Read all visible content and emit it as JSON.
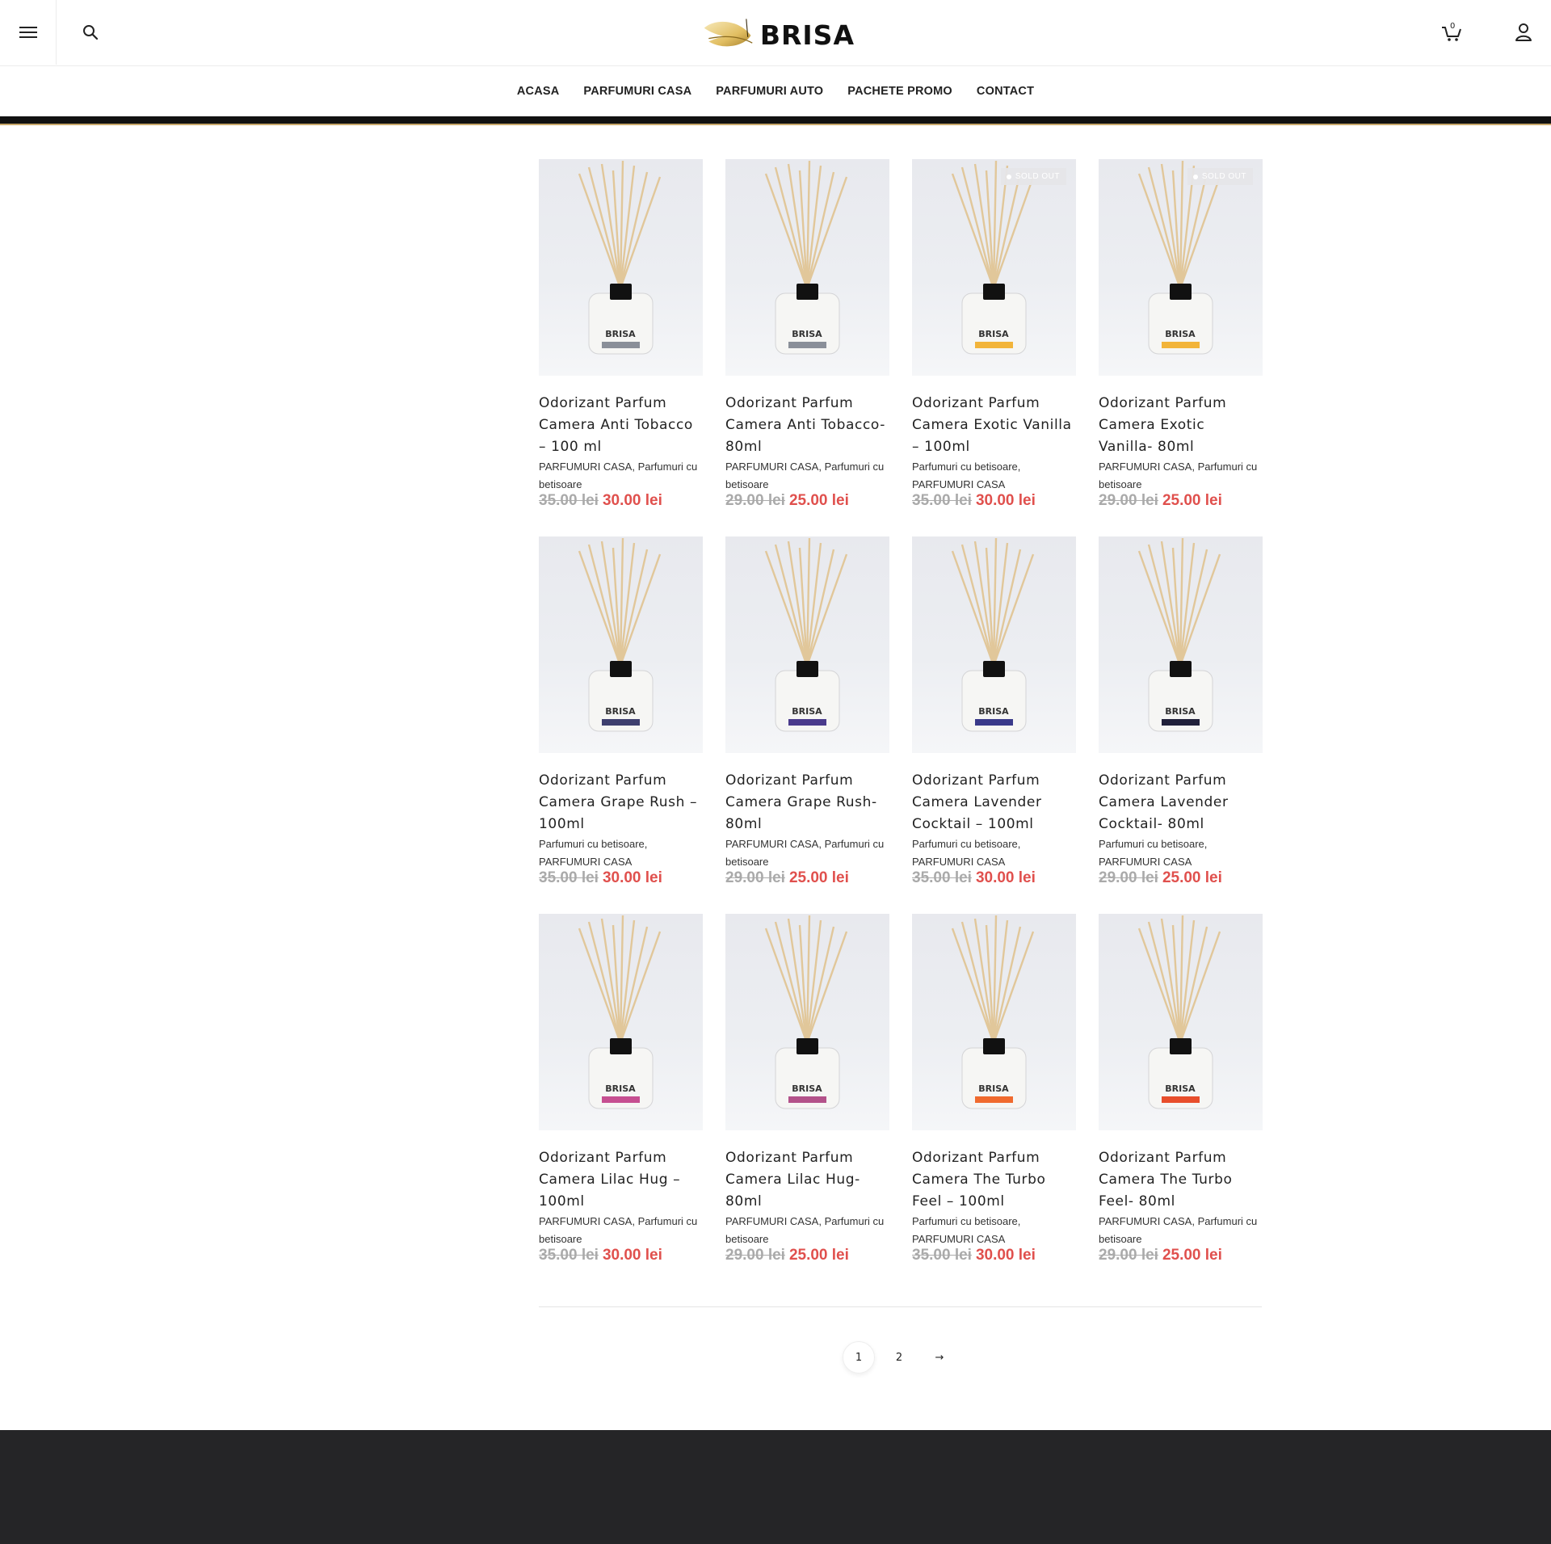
{
  "header": {
    "menu_icon": "hamburger-icon",
    "search_icon": "search-icon",
    "logo_text": "BRISA",
    "cart_count": "0",
    "cart_icon": "cart-icon",
    "account_icon": "user-icon"
  },
  "nav": {
    "items": [
      {
        "label": "ACASA"
      },
      {
        "label": "PARFUMURI CASA"
      },
      {
        "label": "PARFUMURI AUTO"
      },
      {
        "label": "PACHETE PROMO"
      },
      {
        "label": "CONTACT"
      }
    ]
  },
  "colors": {
    "sale_price": "#e0504d",
    "old_price": "#aaaaaa",
    "footer_bg": "#252527"
  },
  "products": [
    {
      "title": "Odorizant Parfum Camera Anti Tobacco – 100 ml",
      "cat1": "PARFUMURI CASA",
      "cat2": "Parfumuri cu betisoare",
      "old_price": "35.00 lei",
      "price": "30.00 lei",
      "badge": "",
      "label_color": "#8a8f99"
    },
    {
      "title": "Odorizant Parfum Camera Anti Tobacco- 80ml",
      "cat1": "PARFUMURI CASA",
      "cat2": "Parfumuri cu betisoare",
      "old_price": "29.00 lei",
      "price": "25.00 lei",
      "badge": "",
      "label_color": "#8a8f99"
    },
    {
      "title": "Odorizant Parfum Camera Exotic Vanilla – 100ml",
      "cat1": "Parfumuri cu betisoare",
      "cat2": "PARFUMURI CASA",
      "old_price": "35.00 lei",
      "price": "30.00 lei",
      "badge": "SOLD OUT",
      "label_color": "#f2b43a"
    },
    {
      "title": "Odorizant Parfum Camera Exotic Vanilla- 80ml",
      "cat1": "PARFUMURI CASA",
      "cat2": "Parfumuri cu betisoare",
      "old_price": "29.00 lei",
      "price": "25.00 lei",
      "badge": "SOLD OUT",
      "label_color": "#f2b43a"
    },
    {
      "title": "Odorizant Parfum Camera Grape Rush – 100ml",
      "cat1": "Parfumuri cu betisoare",
      "cat2": "PARFUMURI CASA",
      "old_price": "35.00 lei",
      "price": "30.00 lei",
      "badge": "",
      "label_color": "#3e3f6e"
    },
    {
      "title": "Odorizant Parfum Camera Grape Rush- 80ml",
      "cat1": "PARFUMURI CASA",
      "cat2": "Parfumuri cu betisoare",
      "old_price": "29.00 lei",
      "price": "25.00 lei",
      "badge": "",
      "label_color": "#4a3b8c"
    },
    {
      "title": "Odorizant Parfum Camera Lavender Cocktail – 100ml",
      "cat1": "Parfumuri cu betisoare",
      "cat2": "PARFUMURI CASA",
      "old_price": "35.00 lei",
      "price": "30.00 lei",
      "badge": "",
      "label_color": "#3a3a8a"
    },
    {
      "title": "Odorizant Parfum Camera Lavender Cocktail- 80ml",
      "cat1": "Parfumuri cu betisoare",
      "cat2": "PARFUMURI CASA",
      "old_price": "29.00 lei",
      "price": "25.00 lei",
      "badge": "",
      "label_color": "#20203a"
    },
    {
      "title": "Odorizant Parfum Camera Lilac Hug – 100ml",
      "cat1": "PARFUMURI CASA",
      "cat2": "Parfumuri cu betisoare",
      "old_price": "35.00 lei",
      "price": "30.00 lei",
      "badge": "",
      "label_color": "#c64f91"
    },
    {
      "title": "Odorizant Parfum Camera Lilac Hug- 80ml",
      "cat1": "PARFUMURI CASA",
      "cat2": "Parfumuri cu betisoare",
      "old_price": "29.00 lei",
      "price": "25.00 lei",
      "badge": "",
      "label_color": "#b3528a"
    },
    {
      "title": "Odorizant Parfum Camera The Turbo Feel – 100ml",
      "cat1": "Parfumuri cu betisoare",
      "cat2": "PARFUMURI CASA",
      "old_price": "35.00 lei",
      "price": "30.00 lei",
      "badge": "",
      "label_color": "#f06a2e"
    },
    {
      "title": "Odorizant Parfum Camera The Turbo Feel- 80ml",
      "cat1": "PARFUMURI CASA",
      "cat2": "Parfumuri cu betisoare",
      "old_price": "29.00 lei",
      "price": "25.00 lei",
      "badge": "",
      "label_color": "#e84e2c"
    }
  ],
  "pagination": {
    "pages": [
      "1",
      "2"
    ],
    "current": "1",
    "next_label": "→"
  }
}
